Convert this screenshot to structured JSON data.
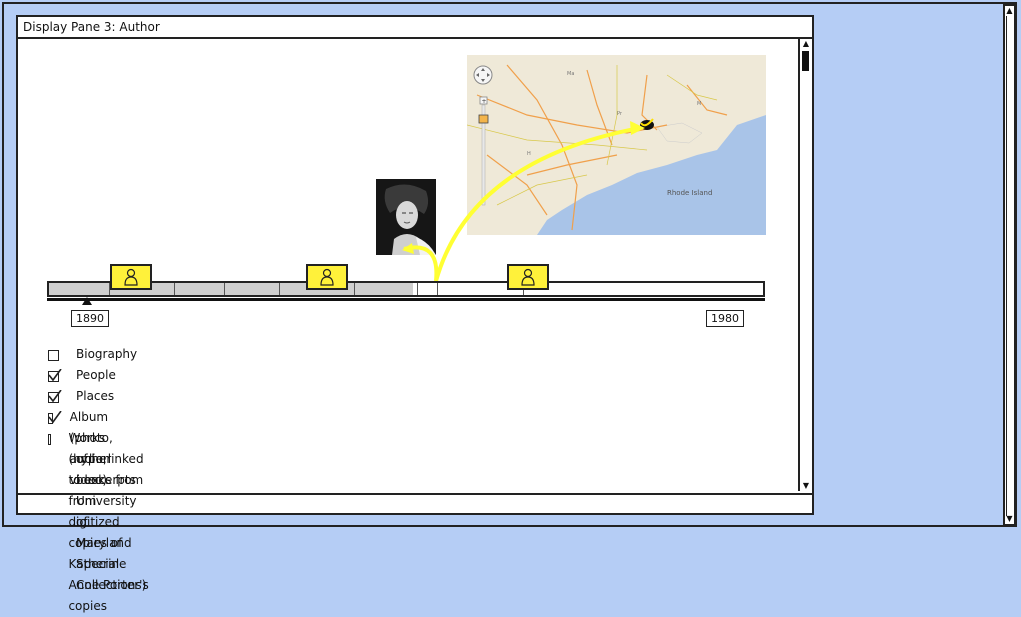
{
  "pane": {
    "title": "Display Pane 3: Author"
  },
  "timeline": {
    "start_year": "1890",
    "end_year": "1980",
    "filled_fraction": 0.51
  },
  "filters": [
    {
      "label": "Biography",
      "checked": false
    },
    {
      "label": "People",
      "checked": true
    },
    {
      "label": "Places",
      "checked": true
    },
    {
      "label": "Album (photo, audio, video)",
      "checked": true
    },
    {
      "label": "Works (hyperlinked to excerpts from digitized copies of Katherine Anne Porter's copies",
      "checked": false
    },
    {
      "label": "of her books from University of Maryland Special Collections)",
      "continuation": true
    }
  ],
  "map": {
    "sea_label": "Rhode Island"
  },
  "colors": {
    "accent_yellow": "#fff13a",
    "map_water": "#a9c4e8",
    "map_land": "#efe9d8",
    "window_bg": "#b5cdf5"
  },
  "icons": [
    "person-icon",
    "map-pin-icon",
    "zoom-slider-icon",
    "pan-control-icon"
  ]
}
